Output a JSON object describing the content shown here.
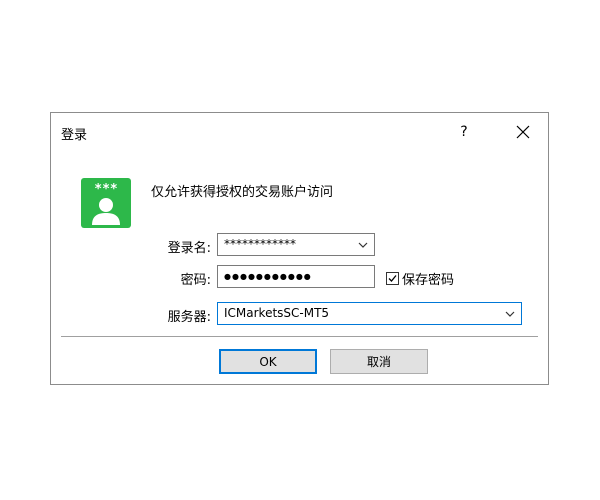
{
  "dialog": {
    "title": "登录",
    "help_label": "?",
    "message": "仅允许获得授权的交易账户访问"
  },
  "icons": {
    "app": "login-user-icon",
    "close": "close-icon",
    "dropdown": "chevron-down-icon",
    "check": "checkmark-icon"
  },
  "colors": {
    "icon_green": "#2db84a",
    "focus_blue": "#0078d7",
    "button_face": "#e1e1e1"
  },
  "app_icon_text": "***",
  "form": {
    "login_label": "登录名:",
    "login_value": "************",
    "password_label": "密码:",
    "password_value": "●●●●●●●●●●●",
    "save_password_label": "保存密码",
    "save_password_checked": true,
    "server_label": "服务器:",
    "server_value": "ICMarketsSC-MT5"
  },
  "buttons": {
    "ok_label": "OK",
    "cancel_label": "取消"
  }
}
